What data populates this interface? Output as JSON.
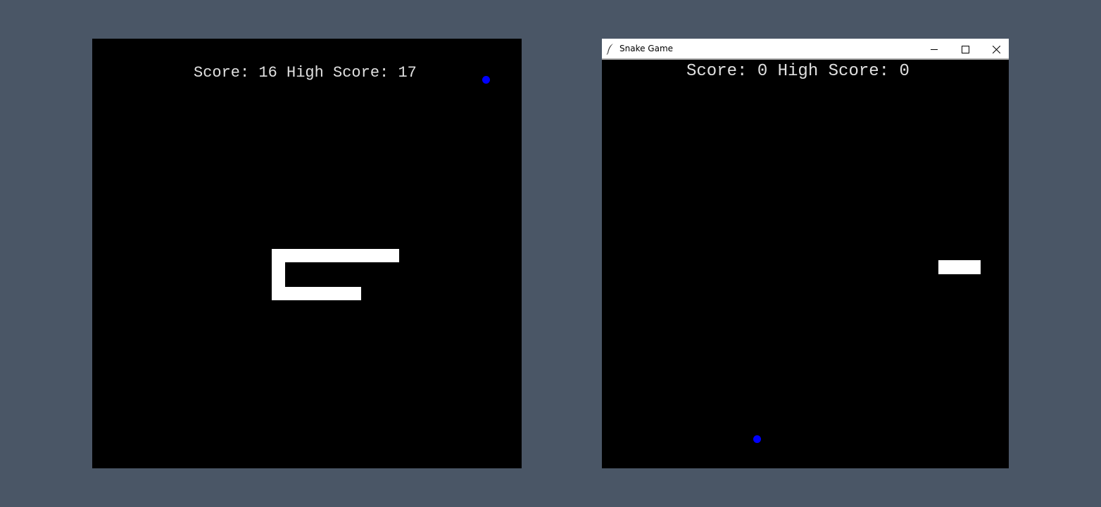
{
  "left_game": {
    "score_label": "Score: 16 High Score: 17",
    "score": 16,
    "high_score": 17,
    "snake_color": "#ffffff",
    "food_color": "#0000ff",
    "background": "#000000"
  },
  "right_window": {
    "title": "Snake Game",
    "app_icon": "feather-icon",
    "controls": [
      "minimize-icon",
      "maximize-icon",
      "close-icon"
    ],
    "score_label": "Score: 0 High Score: 0",
    "score": 0,
    "high_score": 0,
    "snake_color": "#ffffff",
    "food_color": "#0000ff",
    "background": "#000000"
  },
  "desktop_background": "#4a5666"
}
